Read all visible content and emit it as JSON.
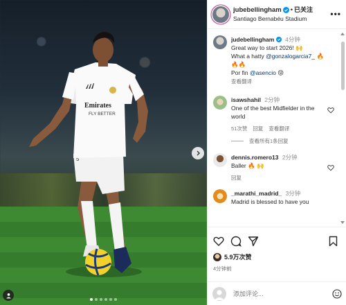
{
  "post": {
    "username": "jubebellingham",
    "follow_state": "已关注",
    "location": "Santiago Bernabéu Stadium",
    "more_icon": "more-horizontal-icon"
  },
  "photo": {
    "jersey_sponsor_line1": "Emirates",
    "jersey_sponsor_line2": "FLY BETTER",
    "carousel_total": 6,
    "carousel_active": 1
  },
  "caption": {
    "username": "judebellingham",
    "time": "4分钟",
    "line1": "Great way to start 2026! 🙌",
    "line2_prefix": "What a hatty ",
    "line2_mention": "@gonzalogarcia7_",
    "line2_suffix": " 🔥",
    "line3": "🔥🔥",
    "line4_prefix": "Por fin ",
    "line4_mention": "@asencio",
    "line4_suffix": " 😝",
    "translate": "查看翻译"
  },
  "comments": [
    {
      "username": "isawshahil",
      "time": "2分钟",
      "text": "One of the best Midfielder in the world",
      "likes": "51次赞",
      "reply": "回复",
      "translate": "查看翻译",
      "view_replies": "查看所有1条回复"
    },
    {
      "username": "dennis.romero13",
      "time": "2分钟",
      "text": "Baller 🔥 🙌",
      "reply": "回复"
    },
    {
      "username": "_marathi_madrid_",
      "time": "3分钟",
      "text": "Madrid is blessed to have you"
    }
  ],
  "actions": {
    "likes": "5.9万次赞",
    "posted_time": "4分钟前"
  },
  "comment_box": {
    "placeholder": "添加评论..."
  },
  "colors": {
    "verified_blue": "#0095f6",
    "mention": "#00376b",
    "muted": "#737373"
  }
}
